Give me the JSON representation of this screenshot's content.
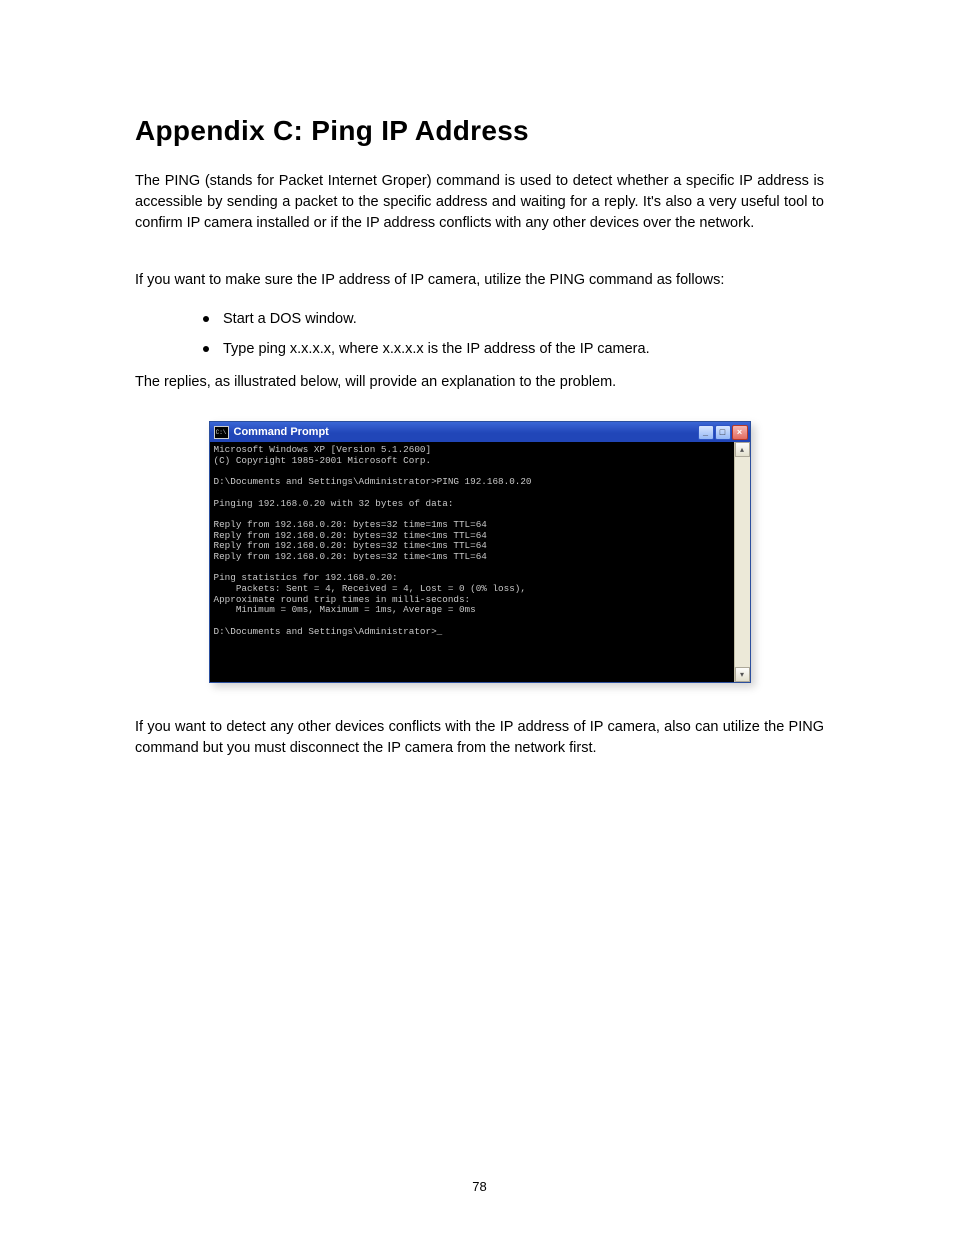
{
  "title": "Appendix C:  Ping IP Address",
  "para1": "The PING (stands for Packet Internet Groper) command is used to detect whether a specific IP address is accessible by sending a packet to the specific address and waiting for a reply. It's also a very useful tool to confirm IP camera installed or if the IP address conflicts with any other devices over the network.",
  "para2": "If you want to make sure the IP address of IP camera, utilize the PING command as follows:",
  "bullets": [
    "Start a DOS window.",
    "Type ping x.x.x.x, where x.x.x.x is the IP address of the IP camera."
  ],
  "para3": "The replies, as illustrated below, will provide an explanation to the problem.",
  "para4": "If you want to detect any other devices conflicts with the IP address of IP camera, also can utilize the PING command but you must disconnect the IP camera from the network first.",
  "page_number": "78",
  "cmd": {
    "title": "Command Prompt",
    "icon_label": "C:\\",
    "minimize": "_",
    "maximize": "□",
    "close": "×",
    "scroll_up": "▴",
    "scroll_down": "▾",
    "body": "Microsoft Windows XP [Version 5.1.2600]\n(C) Copyright 1985-2001 Microsoft Corp.\n\nD:\\Documents and Settings\\Administrator>PING 192.168.0.20\n\nPinging 192.168.0.20 with 32 bytes of data:\n\nReply from 192.168.0.20: bytes=32 time=1ms TTL=64\nReply from 192.168.0.20: bytes=32 time<1ms TTL=64\nReply from 192.168.0.20: bytes=32 time<1ms TTL=64\nReply from 192.168.0.20: bytes=32 time<1ms TTL=64\n\nPing statistics for 192.168.0.20:\n    Packets: Sent = 4, Received = 4, Lost = 0 (0% loss),\nApproximate round trip times in milli-seconds:\n    Minimum = 0ms, Maximum = 1ms, Average = 0ms\n\nD:\\Documents and Settings\\Administrator>_"
  }
}
